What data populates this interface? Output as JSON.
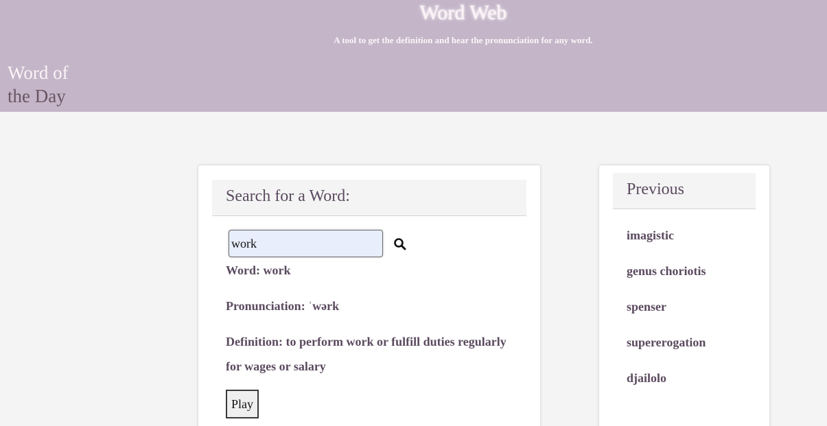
{
  "header": {
    "title": "Word Web",
    "subtitle": "A tool to get the definition and hear the pronunciation for any word.",
    "word_of_day_line1": "Word of",
    "word_of_day_line2": "the Day"
  },
  "search": {
    "heading": "Search for a Word:",
    "input_value": "work",
    "search_icon": "magnifier-icon",
    "word_line": "Word: work",
    "pronunciation_line": "Pronunciation: ˈwərk",
    "definition_line": "Definition: to perform work or fulfill duties regularly for wages or salary",
    "play_label": "Play"
  },
  "previous": {
    "heading": "Previous",
    "items": [
      "imagistic",
      "genus choriotis",
      "spenser",
      "supererogation",
      "djailolo"
    ]
  },
  "colors": {
    "header_bg": "#c4b5c8",
    "page_bg": "#f4f4f4",
    "text": "#5b4a5f"
  }
}
